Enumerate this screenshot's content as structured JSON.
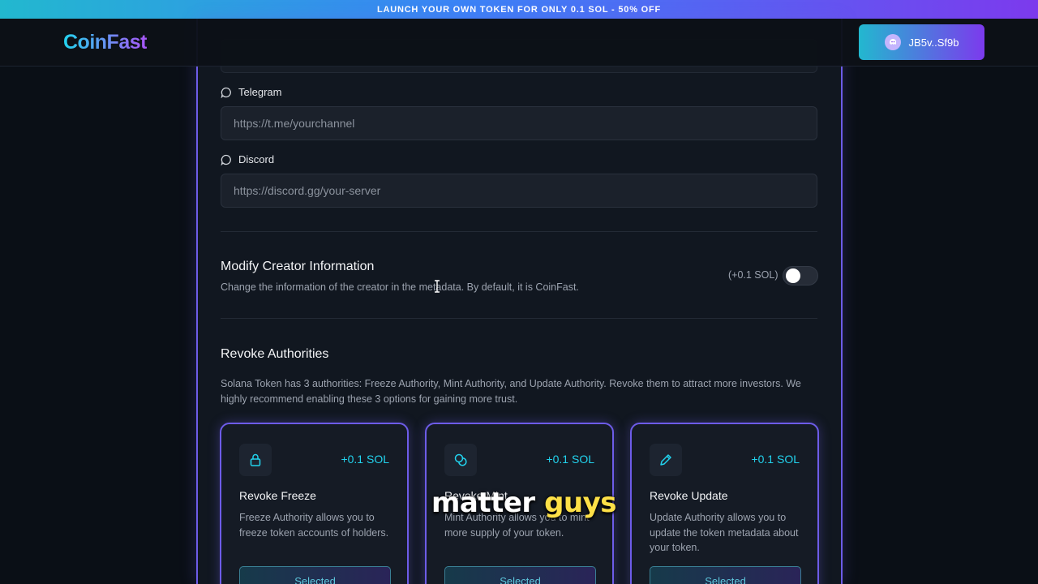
{
  "promo_banner": "LAUNCH YOUR OWN TOKEN FOR ONLY 0.1 SOL - 50% OFF",
  "header": {
    "logo": "CoinFast",
    "wallet_address": "JB5v..Sf9b"
  },
  "form": {
    "telegram": {
      "label": "Telegram",
      "placeholder": "https://t.me/yourchannel"
    },
    "discord": {
      "label": "Discord",
      "placeholder": "https://discord.gg/your-server"
    }
  },
  "creator_info": {
    "title": "Modify Creator Information",
    "description": "Change the information of the creator in the metadata. By default, it is CoinFast.",
    "price": "(+0.1 SOL)",
    "enabled": false
  },
  "revoke": {
    "title": "Revoke Authorities",
    "description": "Solana Token has 3 authorities: Freeze Authority, Mint Authority, and Update Authority. Revoke them to attract more investors. We highly recommend enabling these 3 options for gaining more trust.",
    "cards": [
      {
        "icon": "lock-icon",
        "price": "+0.1 SOL",
        "title": "Revoke Freeze",
        "description": "Freeze Authority allows you to freeze token accounts of holders.",
        "button": "Selected"
      },
      {
        "icon": "coins-icon",
        "price": "+0.1 SOL",
        "title": "Revoke Mint",
        "description": "Mint Authority allows you to mint more supply of your token.",
        "button": "Selected"
      },
      {
        "icon": "pencil-icon",
        "price": "+0.1 SOL",
        "title": "Revoke Update",
        "description": "Update Authority allows you to update the token metadata about your token.",
        "button": "Selected"
      }
    ]
  },
  "subtitle": {
    "word1": "matter",
    "word2": "guys"
  },
  "colors": {
    "accent_cyan": "#22d3ee",
    "accent_purple": "#6d5ce8",
    "background": "#0d1117"
  }
}
